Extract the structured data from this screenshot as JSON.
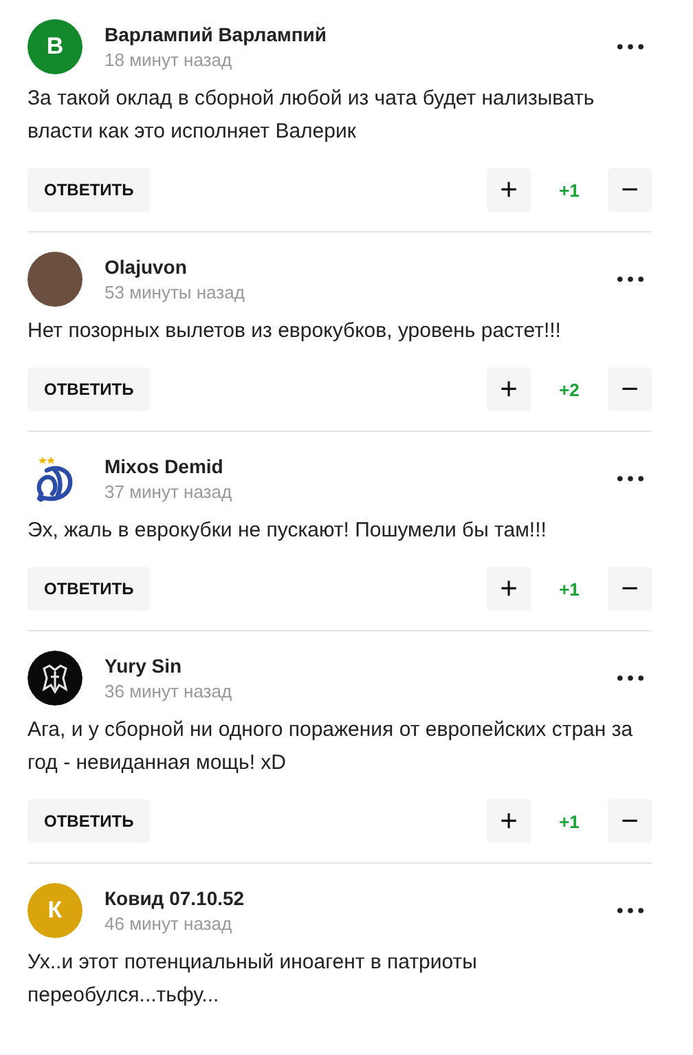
{
  "comments": [
    {
      "author": "Варлампий Варлампий",
      "time": "18 минут назад",
      "avatar": {
        "kind": "letter",
        "letter": "В",
        "color": "#14892c"
      },
      "text": "За такой оклад в сборной любой из чата будет нализывать власти как это исполняет Валерик",
      "reply": "ОТВЕТИТЬ",
      "plus": "+",
      "score": "+1",
      "minus": "−"
    },
    {
      "author": "Olajuvon",
      "time": "53 минуты назад",
      "avatar": {
        "kind": "photo"
      },
      "text": "Нет позорных вылетов из еврокубков, уровень растет!!!",
      "reply": "ОТВЕТИТЬ",
      "plus": "+",
      "score": "+2",
      "minus": "−"
    },
    {
      "author": "Mixos Demid",
      "time": "37 минут назад",
      "avatar": {
        "kind": "logo"
      },
      "text": "Эх, жаль в еврокубки не пускают! Пошумели бы там!!!",
      "reply": "ОТВЕТИТЬ",
      "plus": "+",
      "score": "+1",
      "minus": "−"
    },
    {
      "author": "Yury Sin",
      "time": "36 минут назад",
      "avatar": {
        "kind": "emblem"
      },
      "text": "Ага, и у сборной ни одного поражения от европейских стран за год - невиданная мощь! xD",
      "reply": "ОТВЕТИТЬ",
      "plus": "+",
      "score": "+1",
      "minus": "−"
    },
    {
      "author": "Ковид 07.10.52",
      "time": "46 минут назад",
      "avatar": {
        "kind": "letter",
        "letter": "К",
        "color": "#d9a40c"
      },
      "text": "Ух..и этот потенциальный иноагент в патриоты переобулся...тьфу..."
    }
  ]
}
